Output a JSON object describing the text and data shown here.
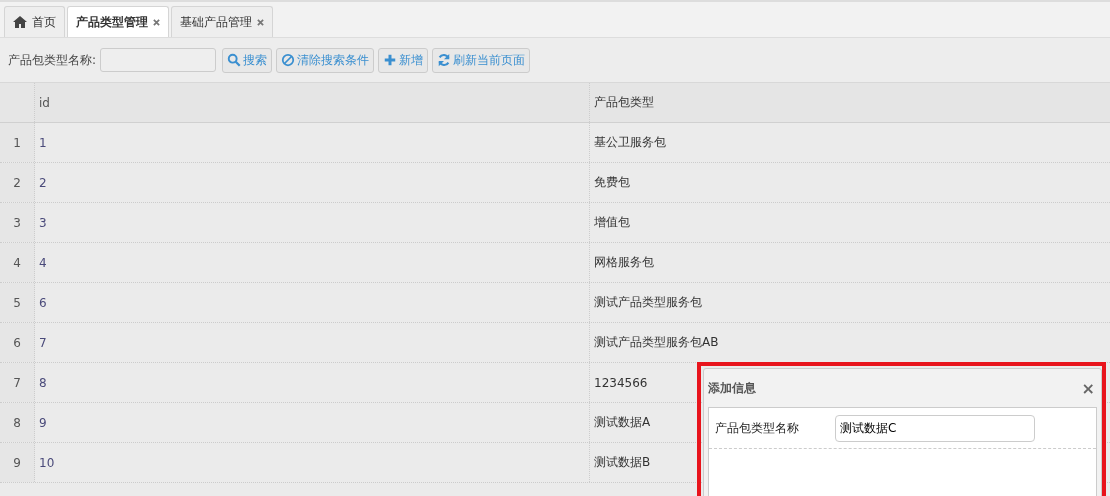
{
  "tabs": [
    {
      "label": "首页",
      "kind": "home",
      "closable": false,
      "selected": false
    },
    {
      "label": "产品类型管理",
      "kind": "page",
      "closable": true,
      "selected": true
    },
    {
      "label": "基础产品管理",
      "kind": "page",
      "closable": true,
      "selected": false
    }
  ],
  "toolbar": {
    "search_label": "产品包类型名称:",
    "buttons": [
      {
        "label": "搜索",
        "kind": "search"
      },
      {
        "label": "清除搜索条件",
        "kind": "clear"
      },
      {
        "label": "新增",
        "kind": "add"
      },
      {
        "label": "刷新当前页面",
        "kind": "refresh"
      }
    ]
  },
  "table": {
    "columns": [
      "id",
      "产品包类型"
    ],
    "rows": [
      {
        "num": "1",
        "id": "1",
        "type": "基公卫服务包"
      },
      {
        "num": "2",
        "id": "2",
        "type": "免费包"
      },
      {
        "num": "3",
        "id": "3",
        "type": "增值包"
      },
      {
        "num": "4",
        "id": "4",
        "type": "网格服务包"
      },
      {
        "num": "5",
        "id": "6",
        "type": "测试产品类型服务包"
      },
      {
        "num": "6",
        "id": "7",
        "type": "测试产品类型服务包AB"
      },
      {
        "num": "7",
        "id": "8",
        "type": "1234566"
      },
      {
        "num": "8",
        "id": "9",
        "type": "测试数据A"
      },
      {
        "num": "9",
        "id": "10",
        "type": "测试数据B"
      }
    ]
  },
  "dialog": {
    "title": "添加信息",
    "close": "×",
    "field_label": "产品包类型名称",
    "field_value": "测试数据C",
    "highlighted": true
  }
}
